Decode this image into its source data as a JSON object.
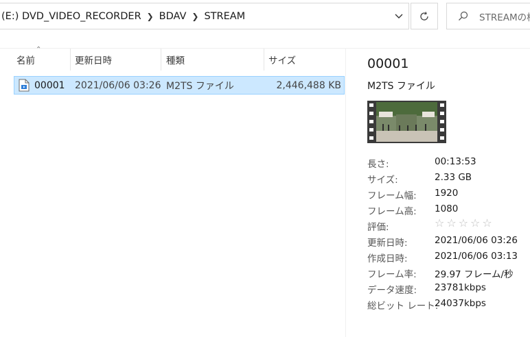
{
  "address": {
    "crumbs": [
      "(E:) DVD_VIDEO_RECORDER",
      "BDAV",
      "STREAM"
    ],
    "search_placeholder": "STREAMの検"
  },
  "columns": {
    "name": "名前",
    "date": "更新日時",
    "type": "種類",
    "size": "サイズ"
  },
  "files": [
    {
      "name": "00001",
      "date": "2021/06/06 03:26",
      "type": "M2TS ファイル",
      "size": "2,446,488 KB"
    }
  ],
  "details": {
    "title": "00001",
    "type": "M2TS ファイル",
    "properties": [
      {
        "label": "長さ:",
        "value": "00:13:53"
      },
      {
        "label": "サイズ:",
        "value": "2.33 GB"
      },
      {
        "label": "フレーム幅:",
        "value": "1920"
      },
      {
        "label": "フレーム高:",
        "value": "1080"
      },
      {
        "label": "評価:",
        "value": "☆☆☆☆☆",
        "rating": 0
      },
      {
        "label": "更新日時:",
        "value": "2021/06/06 03:26"
      },
      {
        "label": "作成日時:",
        "value": "2021/06/06 03:13"
      },
      {
        "label": "フレーム率:",
        "value": "29.97 フレーム/秒"
      },
      {
        "label": "データ速度:",
        "value": "23781kbps"
      },
      {
        "label": "総ビット レート:",
        "value": "24037kbps"
      }
    ]
  },
  "colors": {
    "selection_bg": "#cce8ff",
    "selection_border": "#99d1ff"
  }
}
